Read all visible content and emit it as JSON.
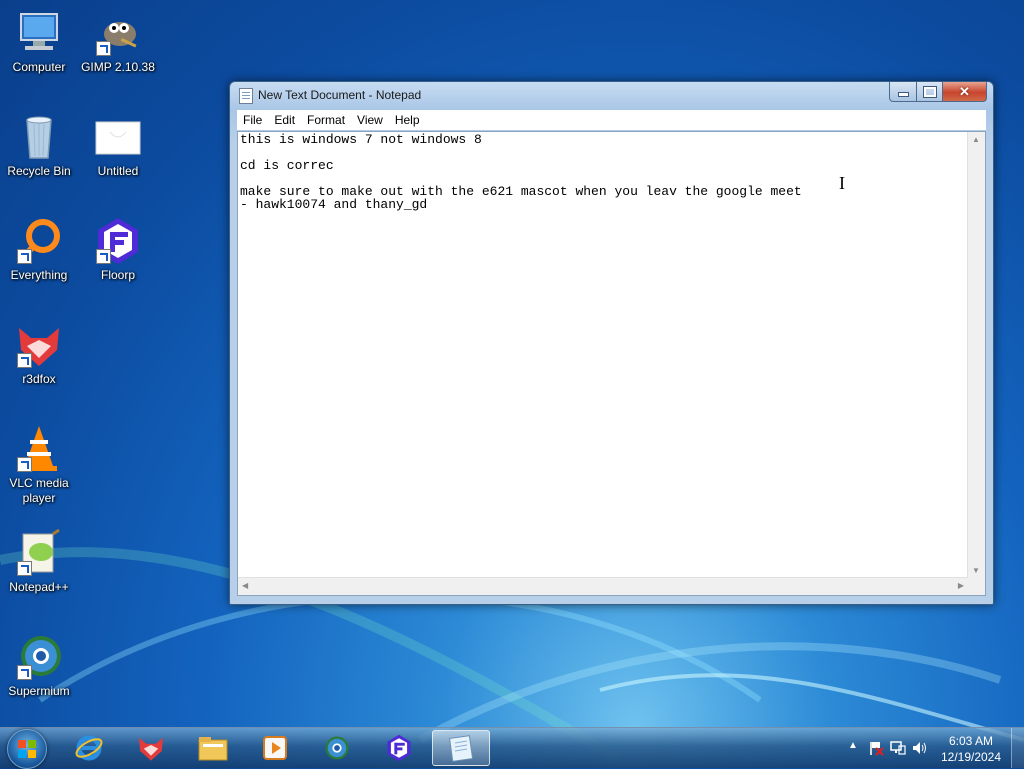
{
  "desktop": {
    "icons": [
      {
        "label": "Computer"
      },
      {
        "label": "GIMP 2.10.38"
      },
      {
        "label": "Recycle Bin"
      },
      {
        "label": "Untitled"
      },
      {
        "label": "Everything"
      },
      {
        "label": "Floorp"
      },
      {
        "label": "r3dfox"
      },
      {
        "label": "VLC media player"
      },
      {
        "label": "Notepad++"
      },
      {
        "label": "Supermium"
      }
    ]
  },
  "window": {
    "title": "New Text Document - Notepad",
    "menu": [
      "File",
      "Edit",
      "Format",
      "View",
      "Help"
    ],
    "content": "this is windows 7 not windows 8\n\ncd is correc\n\nmake sure to make out with the e621 mascot when you leav the google meet\n- hawk10074 and thany_gd"
  },
  "taskbar": {
    "pinned": [
      "internet-explorer-icon",
      "r3dfox-icon",
      "explorer-folder-icon",
      "media-player-icon",
      "supermium-icon",
      "floorp-icon",
      "notepad-icon"
    ],
    "clock_time": "6:03 AM",
    "clock_date": "12/19/2024"
  },
  "colors": {
    "desktop_accent": "#1363be",
    "close_button": "#c8452d"
  }
}
